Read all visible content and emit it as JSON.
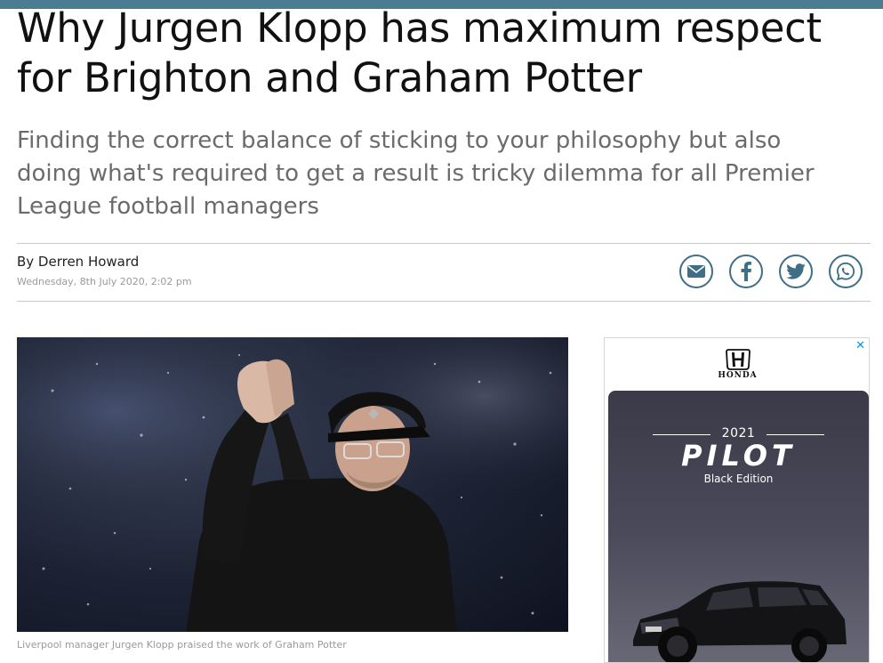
{
  "article": {
    "headline": "Why Jurgen Klopp has maximum respect for Brighton and Graham Potter",
    "standfirst": "Finding the correct balance of sticking to your philosophy but also doing what's required to get a result is tricky dilemma for all Premier League football managers",
    "byline": "By Derren Howard",
    "dateline": "Wednesday, 8th July 2020, 2:02 pm",
    "caption": "Liverpool manager Jurgen Klopp praised the work of Graham Potter"
  },
  "share": {
    "icons": [
      "email-icon",
      "facebook-icon",
      "twitter-icon",
      "whatsapp-icon"
    ]
  },
  "ad": {
    "close": "✕",
    "brand": "HONDA",
    "year": "2021",
    "model": "PILOT",
    "edition": "Black Edition"
  },
  "colors": {
    "accent_bar": "#4a7c93",
    "share_icon": "#3f6f86",
    "headline": "#111111",
    "standfirst": "#6b6b6b",
    "ad_close": "#1a8fd8"
  }
}
